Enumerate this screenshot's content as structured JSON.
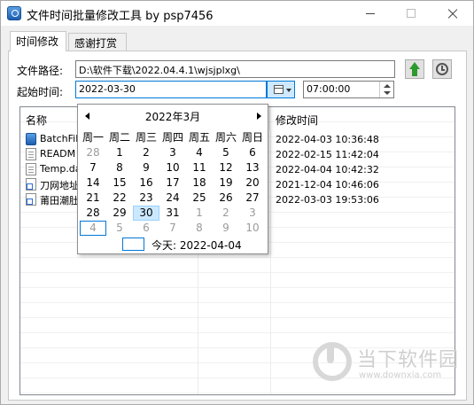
{
  "window": {
    "title": "文件时间批量修改工具 by psp7456",
    "controls": {
      "minimize": "—",
      "maximize": "☐",
      "close": "✕"
    }
  },
  "tabs": [
    {
      "label": "时间修改",
      "active": true
    },
    {
      "label": "感谢打赏",
      "active": false
    }
  ],
  "form": {
    "path_label": "文件路径:",
    "path_value": "D:\\软件下载\\2022.04.4.1\\wjsjplxg\\",
    "start_label": "起始时间:",
    "date_value": "2022-03-30",
    "time_value": "07:00:00",
    "icons": {
      "up": "green-up-arrow-icon",
      "history": "history-clock-icon"
    }
  },
  "file_list": {
    "columns": {
      "name": "名称",
      "modified": "修改时间"
    },
    "rows": [
      {
        "name": "BatchFile",
        "icon": "app-icon",
        "modified": "2022-04-03 10:36:48"
      },
      {
        "name": "READM",
        "icon": "document-icon",
        "modified": "2022-02-15 11:42:04"
      },
      {
        "name": "Temp.da",
        "icon": "file-icon",
        "modified": "2022-04-04 10:42:32"
      },
      {
        "name": "刀网地址",
        "icon": "shortcut-icon",
        "modified": "2021-12-04 10:46:06"
      },
      {
        "name": "莆田潮肚",
        "icon": "shortcut-icon",
        "modified": "2022-03-03 19:53:06"
      }
    ]
  },
  "calendar": {
    "title": "2022年3月",
    "weekdays": [
      "周一",
      "周二",
      "周三",
      "周四",
      "周五",
      "周六",
      "周日"
    ],
    "weeks": [
      [
        "28",
        "1",
        "2",
        "3",
        "4",
        "5",
        "6"
      ],
      [
        "7",
        "8",
        "9",
        "10",
        "11",
        "12",
        "13"
      ],
      [
        "14",
        "15",
        "16",
        "17",
        "18",
        "19",
        "20"
      ],
      [
        "21",
        "22",
        "23",
        "24",
        "25",
        "26",
        "27"
      ],
      [
        "28",
        "29",
        "30",
        "31",
        "1",
        "2",
        "3"
      ],
      [
        "4",
        "5",
        "6",
        "7",
        "8",
        "9",
        "10"
      ]
    ],
    "selected_day": "30",
    "today_label": "今天: 2022-04-04"
  },
  "watermark": {
    "text": "当下软件园",
    "url": "www.downxia.com"
  }
}
